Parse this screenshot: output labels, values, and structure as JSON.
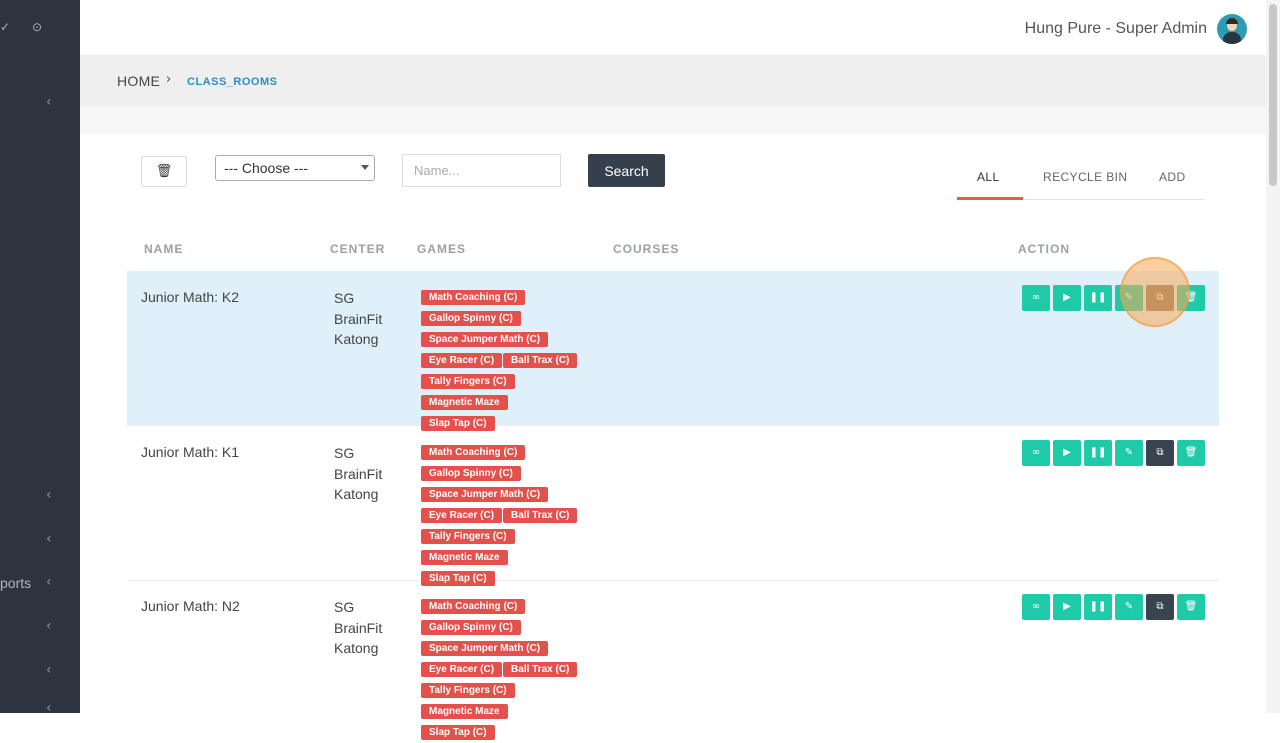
{
  "sidebar": {
    "partial_label": "ports"
  },
  "header": {
    "user_label": "Hung Pure - Super Admin"
  },
  "breadcrumb": {
    "home": "HOME",
    "current": "CLASS_ROOMS"
  },
  "filters": {
    "choose_value": "--- Choose ---",
    "name_placeholder": "Name...",
    "search_label": "Search"
  },
  "tabs": [
    {
      "label": "ALL",
      "active": true
    },
    {
      "label": "RECYCLE BIN",
      "active": false
    },
    {
      "label": "ADD",
      "active": false
    }
  ],
  "table": {
    "headers": {
      "name": "NAME",
      "center": "CENTER",
      "games": "GAMES",
      "courses": "COURSES",
      "action": "ACTION"
    },
    "rows": [
      {
        "name": "Junior Math: K2",
        "center": [
          "SG",
          "BrainFit",
          "Katong"
        ],
        "games": [
          "Math Coaching (C)",
          "Gallop Spinny (C)",
          "Space Jumper Math (C)",
          "Eye Racer (C)",
          "Ball Trax (C)",
          "Tally Fingers (C)",
          "Magnetic Maze",
          "Slap Tap (C)"
        ],
        "highlighted": true
      },
      {
        "name": "Junior Math: K1",
        "center": [
          "SG",
          "BrainFit",
          "Katong"
        ],
        "games": [
          "Math Coaching (C)",
          "Gallop Spinny (C)",
          "Space Jumper Math (C)",
          "Eye Racer (C)",
          "Ball Trax (C)",
          "Tally Fingers (C)",
          "Magnetic Maze",
          "Slap Tap (C)"
        ],
        "highlighted": false
      },
      {
        "name": "Junior Math: N2",
        "center": [
          "SG",
          "BrainFit",
          "Katong"
        ],
        "games": [
          "Math Coaching (C)",
          "Gallop Spinny (C)",
          "Space Jumper Math (C)",
          "Eye Racer (C)",
          "Ball Trax (C)",
          "Tally Fingers (C)",
          "Magnetic Maze",
          "Slap Tap (C)"
        ],
        "highlighted": false
      }
    ]
  },
  "colors": {
    "sidebar": "#2c343f",
    "accent_teal": "#1fcaa9",
    "tag_red": "#e4514d",
    "link_blue": "#2a8ec7",
    "row_highlight": "#dff0fb"
  },
  "icons": {
    "trash": "trash-icon",
    "link": "link-icon",
    "play": "play-icon",
    "pause": "pause-icon",
    "edit": "pencil-icon",
    "copy": "copy-icon",
    "delete": "delete-icon",
    "avatar": "user-avatar"
  }
}
